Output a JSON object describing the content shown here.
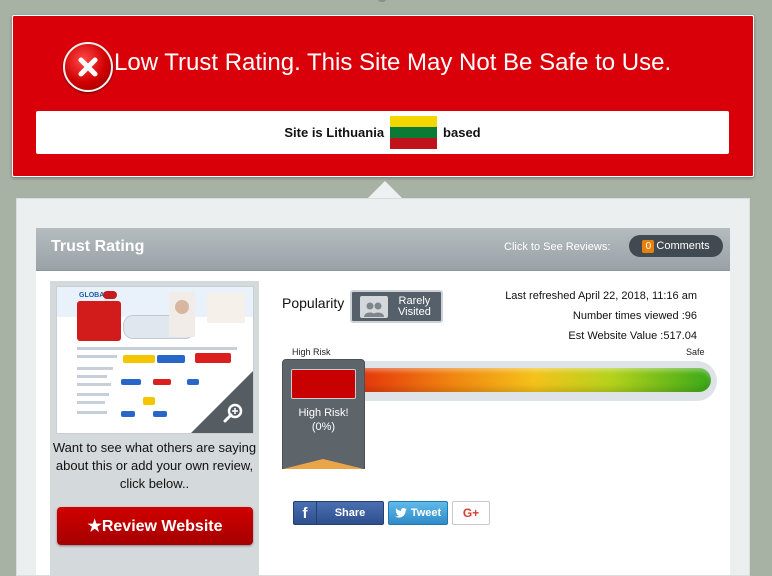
{
  "alert": {
    "title": "Low Trust Rating. This Site May Not Be Safe to Use.",
    "location_prefix": "Site is Lithuania",
    "location_suffix": "based",
    "colors": {
      "background": "#d9000a",
      "flag": [
        "#f4d600",
        "#0a7a34",
        "#c0121b"
      ]
    }
  },
  "card": {
    "title": "Trust Rating",
    "reviews_prompt": "Click to See Reviews:",
    "comments_count": "0",
    "comments_label": "Comments"
  },
  "left": {
    "prompt": "Want to see what others are saying about this or add your own review, click below..",
    "review_button": "★Review Website"
  },
  "popularity": {
    "label": "Popularity",
    "badge_line1": "Rarely",
    "badge_line2": "Visited"
  },
  "meta": {
    "refreshed": "Last refreshed April 22, 2018, 11:16 am",
    "views": "Number times viewed :96",
    "value": "Est Website Value :517.04"
  },
  "gauge": {
    "label_high": "High Risk",
    "label_safe": "Safe",
    "status_line1": "High Risk!",
    "status_line2": "(0%)",
    "level_percent": 0
  },
  "share": {
    "facebook": "Share",
    "twitter": "Tweet",
    "google": "G+"
  }
}
